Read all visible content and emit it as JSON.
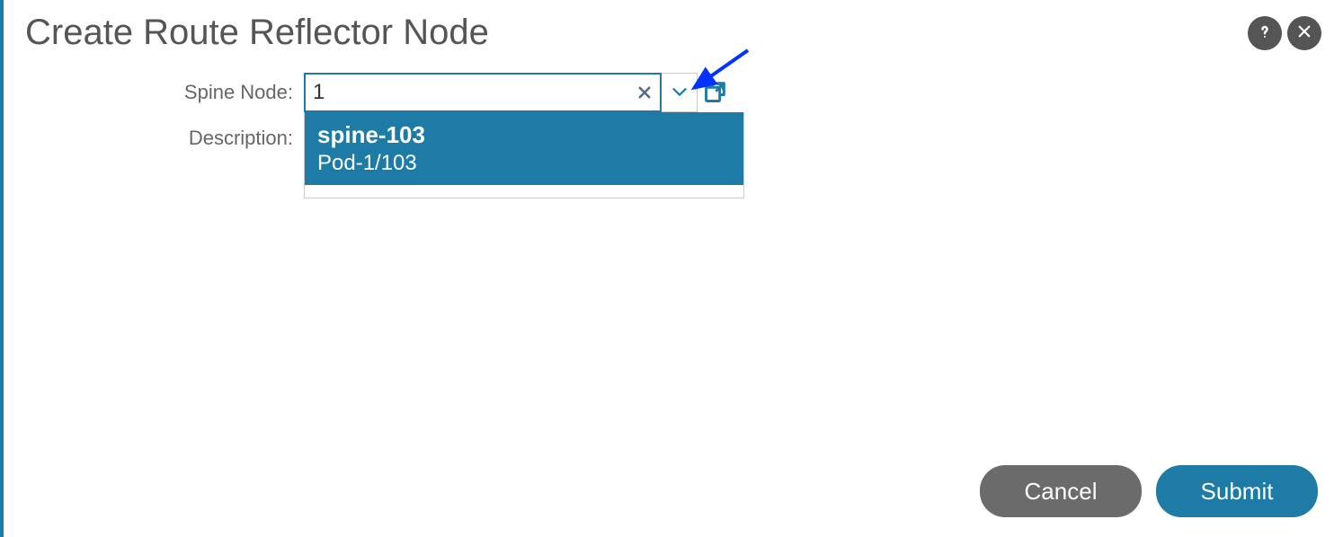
{
  "dialog": {
    "title": "Create Route Reflector Node"
  },
  "form": {
    "spine_node_label": "Spine Node:",
    "spine_node_value": "1",
    "description_label": "Description:",
    "dropdown": {
      "options": [
        {
          "name": "spine-103",
          "path": "Pod-1/103"
        }
      ]
    }
  },
  "footer": {
    "cancel_label": "Cancel",
    "submit_label": "Submit"
  }
}
